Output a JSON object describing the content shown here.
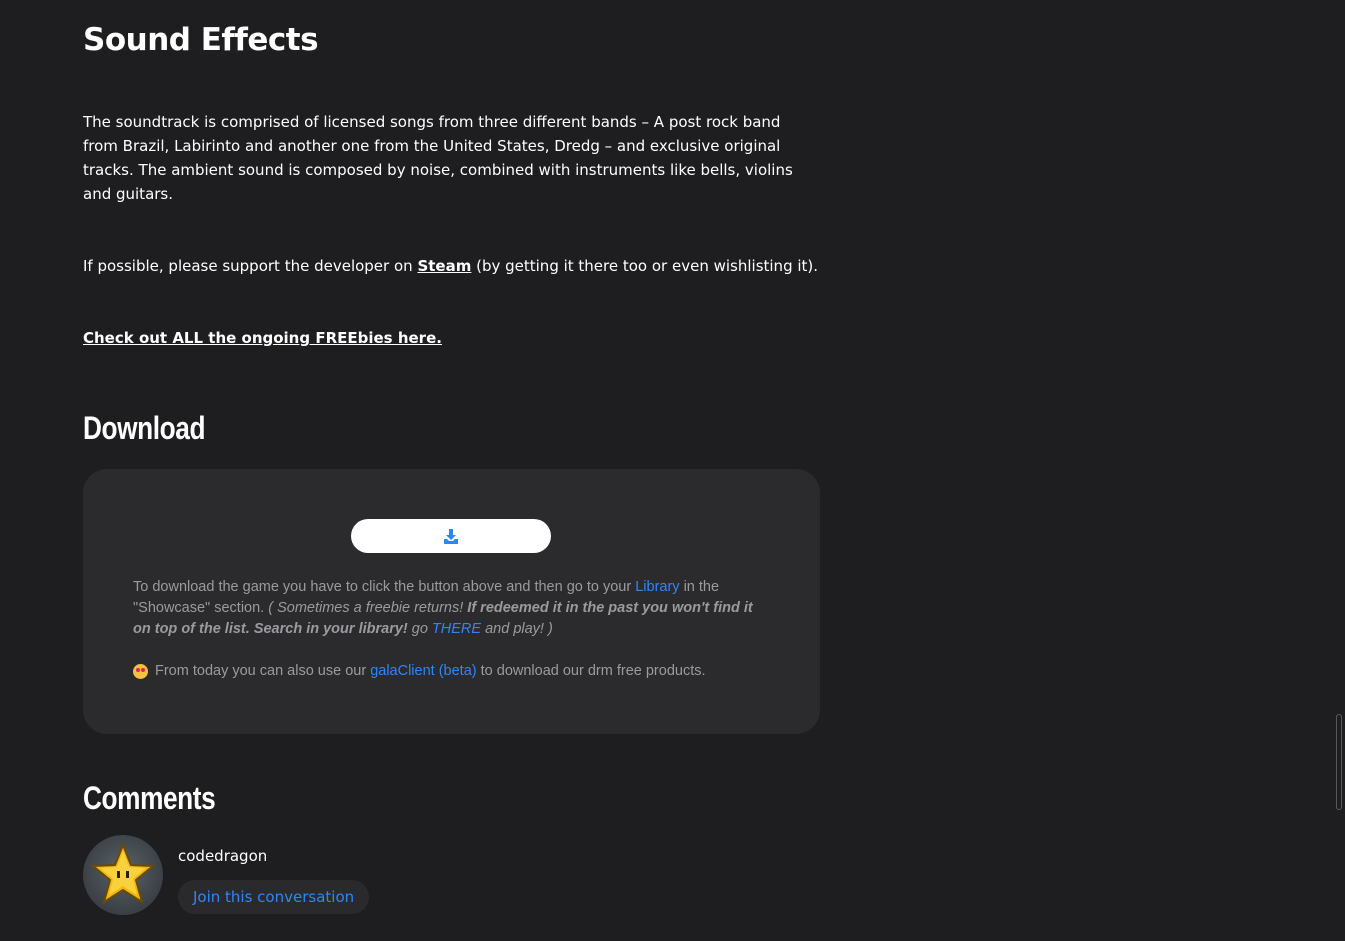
{
  "sound_effects": {
    "title": "Sound Effects",
    "paragraph": "The soundtrack is comprised of licensed songs from three different bands – A post rock band from Brazil, Labirinto and another one from the United States, Dredg – and exclusive original tracks. The ambient sound is composed by noise, combined with instruments like bells, violins and guitars.",
    "support_prefix": "If possible, please support the developer on ",
    "support_link": "Steam",
    "support_suffix": " (by getting it there too or even wishlisting it).",
    "freebies_link": "Check out ALL the ongoing FREEbies here."
  },
  "download": {
    "title": "Download",
    "button_icon": "download-icon",
    "instructions": {
      "part1": "To download the game you have to click the button above and then go to your ",
      "library_link": "Library",
      "part2": " in the \"Showcase\" section. ",
      "italic1": "( Sometimes a freebie returns! ",
      "bold_italic": "If redeemed it in the past you won't find it on top of the list. Search in your library!",
      "italic2": " go ",
      "there_link": "THERE",
      "italic3": " and play! )"
    },
    "note": {
      "emoji_icon": "star-struck-emoji-icon",
      "prefix": "From today you can also use our ",
      "client_link": "galaClient (beta)",
      "suffix": " to download our drm free products."
    }
  },
  "comments": {
    "title": "Comments",
    "username": "codedragon",
    "avatar_icon": "star-avatar-icon",
    "join_label": "Join this conversation"
  },
  "colors": {
    "background": "#1e1e20",
    "card": "#2b2b2e",
    "link_blue": "#2f86f6",
    "muted_text": "#9b9b9f"
  }
}
